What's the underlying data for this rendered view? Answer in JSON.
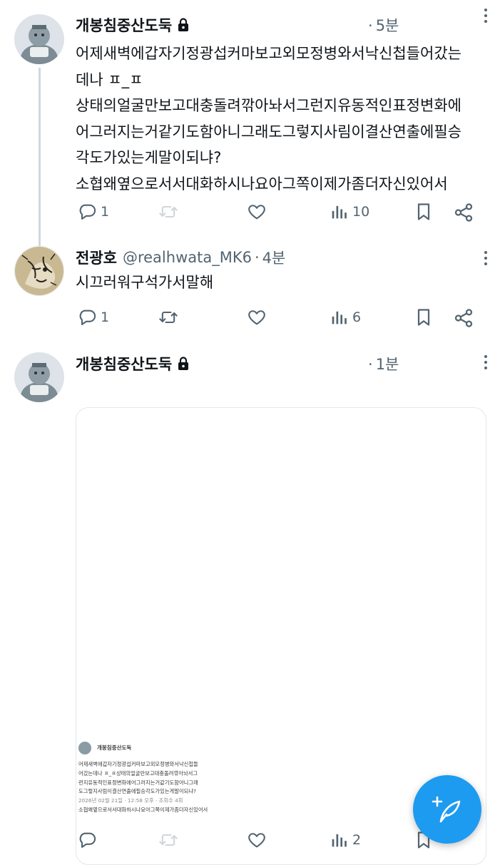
{
  "posts": [
    {
      "name": "개봉침중산도둑",
      "time": "5분",
      "text_lines": [
        "어제새벽에갑자기정광섭커마보고외모정병와서낙신첩들어갔는",
        "데나 ㅍ_ㅍ",
        "상태의얼굴만보고대충돌려깎아놔서그런지유동적인표정변화에",
        "어그러지는거같기도함아니그래도그렇지사림이결산연출에필승",
        "각도가있는게말이되냐?",
        "소협왜옆으로서서대화하시나요아그쪽이제가좀더자신있어서"
      ],
      "reply_count": "1",
      "views": "10"
    },
    {
      "name": "전광호",
      "handle": "@realhwata_MK6",
      "time": "4분",
      "text_lines": [
        "시끄러워구석가서말해"
      ],
      "reply_count": "1",
      "views": "6"
    },
    {
      "name": "개봉침중산도둑",
      "time": "1분",
      "views": "2",
      "embedded": {
        "name": "개봉침중산도둑",
        "lines": [
          "어제새벽에갑자기정광섭커마보고외모정병와서낙신첩들",
          "어갔는데나 ㅍ_ㅍ상태의얼굴만보고대충돌려깎아놔서그",
          "런지유동적인표정변화에어그러지는거같기도함아니그래",
          "도그렇지사림이결산연출에필승각도가있는게말이되냐?",
          "소협왜옆으로서서대화하시나요아그쪽이제가좀더자신있어서"
        ],
        "meta": "2026년 02월 21일 · 12:58 오후 · 조회수 4회"
      }
    }
  ],
  "icons": {
    "reply": "comment-icon",
    "retweet": "retweet-icon",
    "like": "heart-icon",
    "views": "views-icon",
    "bookmark": "bookmark-icon",
    "share": "share-icon",
    "compose": "compose-icon"
  },
  "colors": {
    "accent": "#1d9bf0",
    "muted": "#536471",
    "thread_line": "#cfd9de"
  }
}
